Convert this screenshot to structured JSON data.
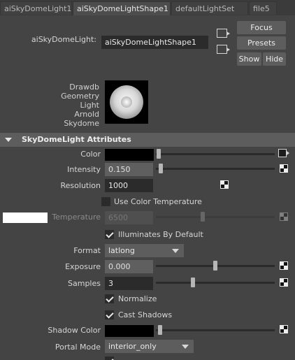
{
  "tabs": [
    "aiSkyDomeLight1",
    "aiSkyDomeLightShape1",
    "defaultLightSet",
    "file5"
  ],
  "node": {
    "label": "aiSkyDomeLight:",
    "value": "aiSkyDomeLightShape1"
  },
  "buttons": {
    "focus": "Focus",
    "presets": "Presets",
    "show": "Show",
    "hide": "Hide"
  },
  "classification": [
    "Drawdb",
    "Geometry",
    "Light",
    "Arnold",
    "Skydome"
  ],
  "section_title": "SkyDomeLight Attributes",
  "attrs": {
    "color": {
      "label": "Color",
      "value_hex": "#000000",
      "slider": 0.0
    },
    "intensity": {
      "label": "Intensity",
      "value": "0.150",
      "slider": 0.01
    },
    "resolution": {
      "label": "Resolution",
      "value": "1000"
    },
    "use_color_temperature": {
      "label": "Use Color Temperature",
      "checked": false
    },
    "temperature": {
      "label": "Temperature",
      "value": "6500",
      "swatch_hex": "#ffffff",
      "slider": 0.33
    },
    "illuminates_by_default": {
      "label": "Illuminates By Default",
      "checked": true
    },
    "format": {
      "label": "Format",
      "value": "latlong"
    },
    "exposure": {
      "label": "Exposure",
      "value": "0.000",
      "slider": 0.5
    },
    "samples": {
      "label": "Samples",
      "value": "3",
      "slider": 0.3
    },
    "normalize": {
      "label": "Normalize",
      "checked": true
    },
    "cast_shadows": {
      "label": "Cast Shadows",
      "checked": true
    },
    "shadow_color": {
      "label": "Shadow Color",
      "value_hex": "#000000",
      "slider": 0.0
    },
    "portal_mode": {
      "label": "Portal Mode",
      "value": "interior_only"
    }
  },
  "colors": {
    "panel_bg": "#444444",
    "field_bg": "#2b2b2b",
    "header_bg": "#5d5d5d",
    "text": "#d6d6d6"
  }
}
